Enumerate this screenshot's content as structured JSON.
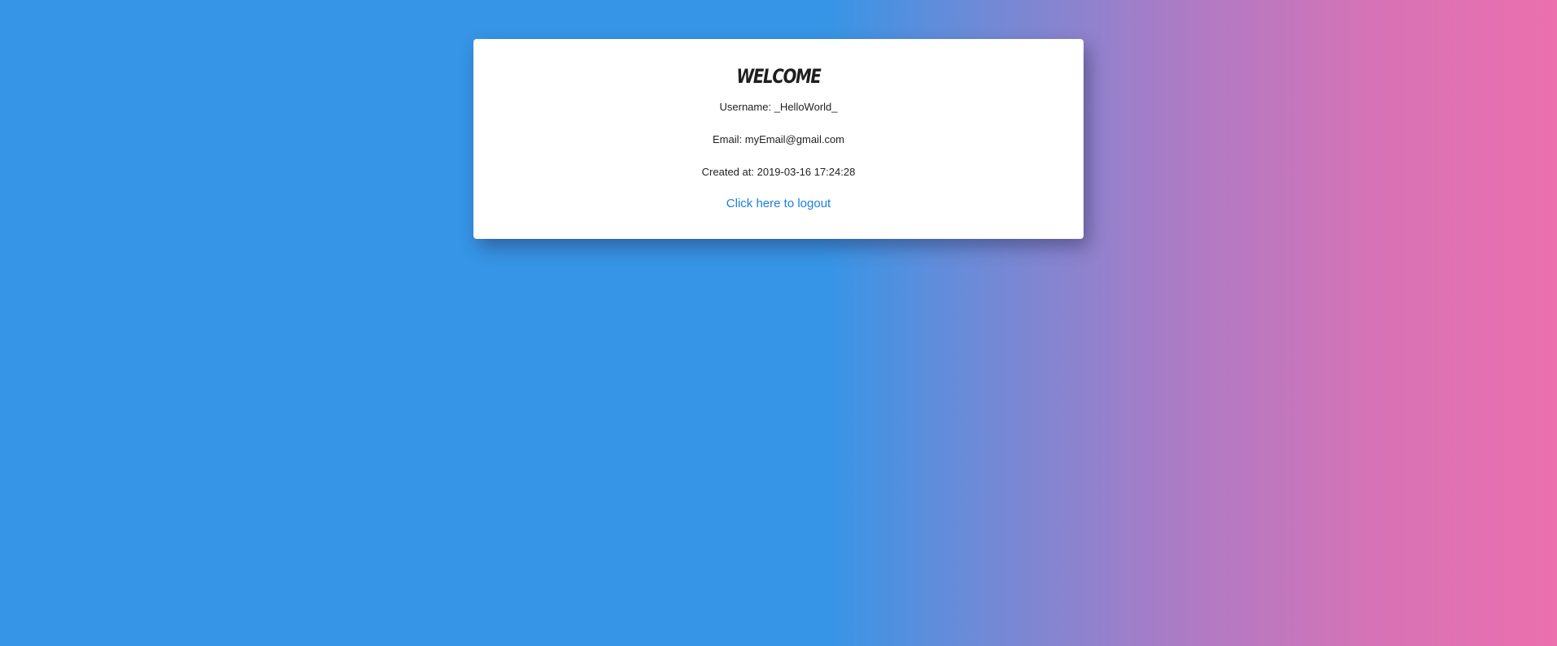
{
  "card": {
    "title": "WELCOME",
    "username_label": "Username:",
    "username_value": "_HelloWorld_",
    "email_label": "Email:",
    "email_value": "myEmail@gmail.com",
    "created_label": "Created at:",
    "created_value": "2019-03-16 17:24:28",
    "logout_link": "Click here to logout"
  },
  "colors": {
    "background_start": "#3695e6",
    "background_end": "#ec6fae",
    "link": "#1a7fe0",
    "card": "#ffffff"
  }
}
